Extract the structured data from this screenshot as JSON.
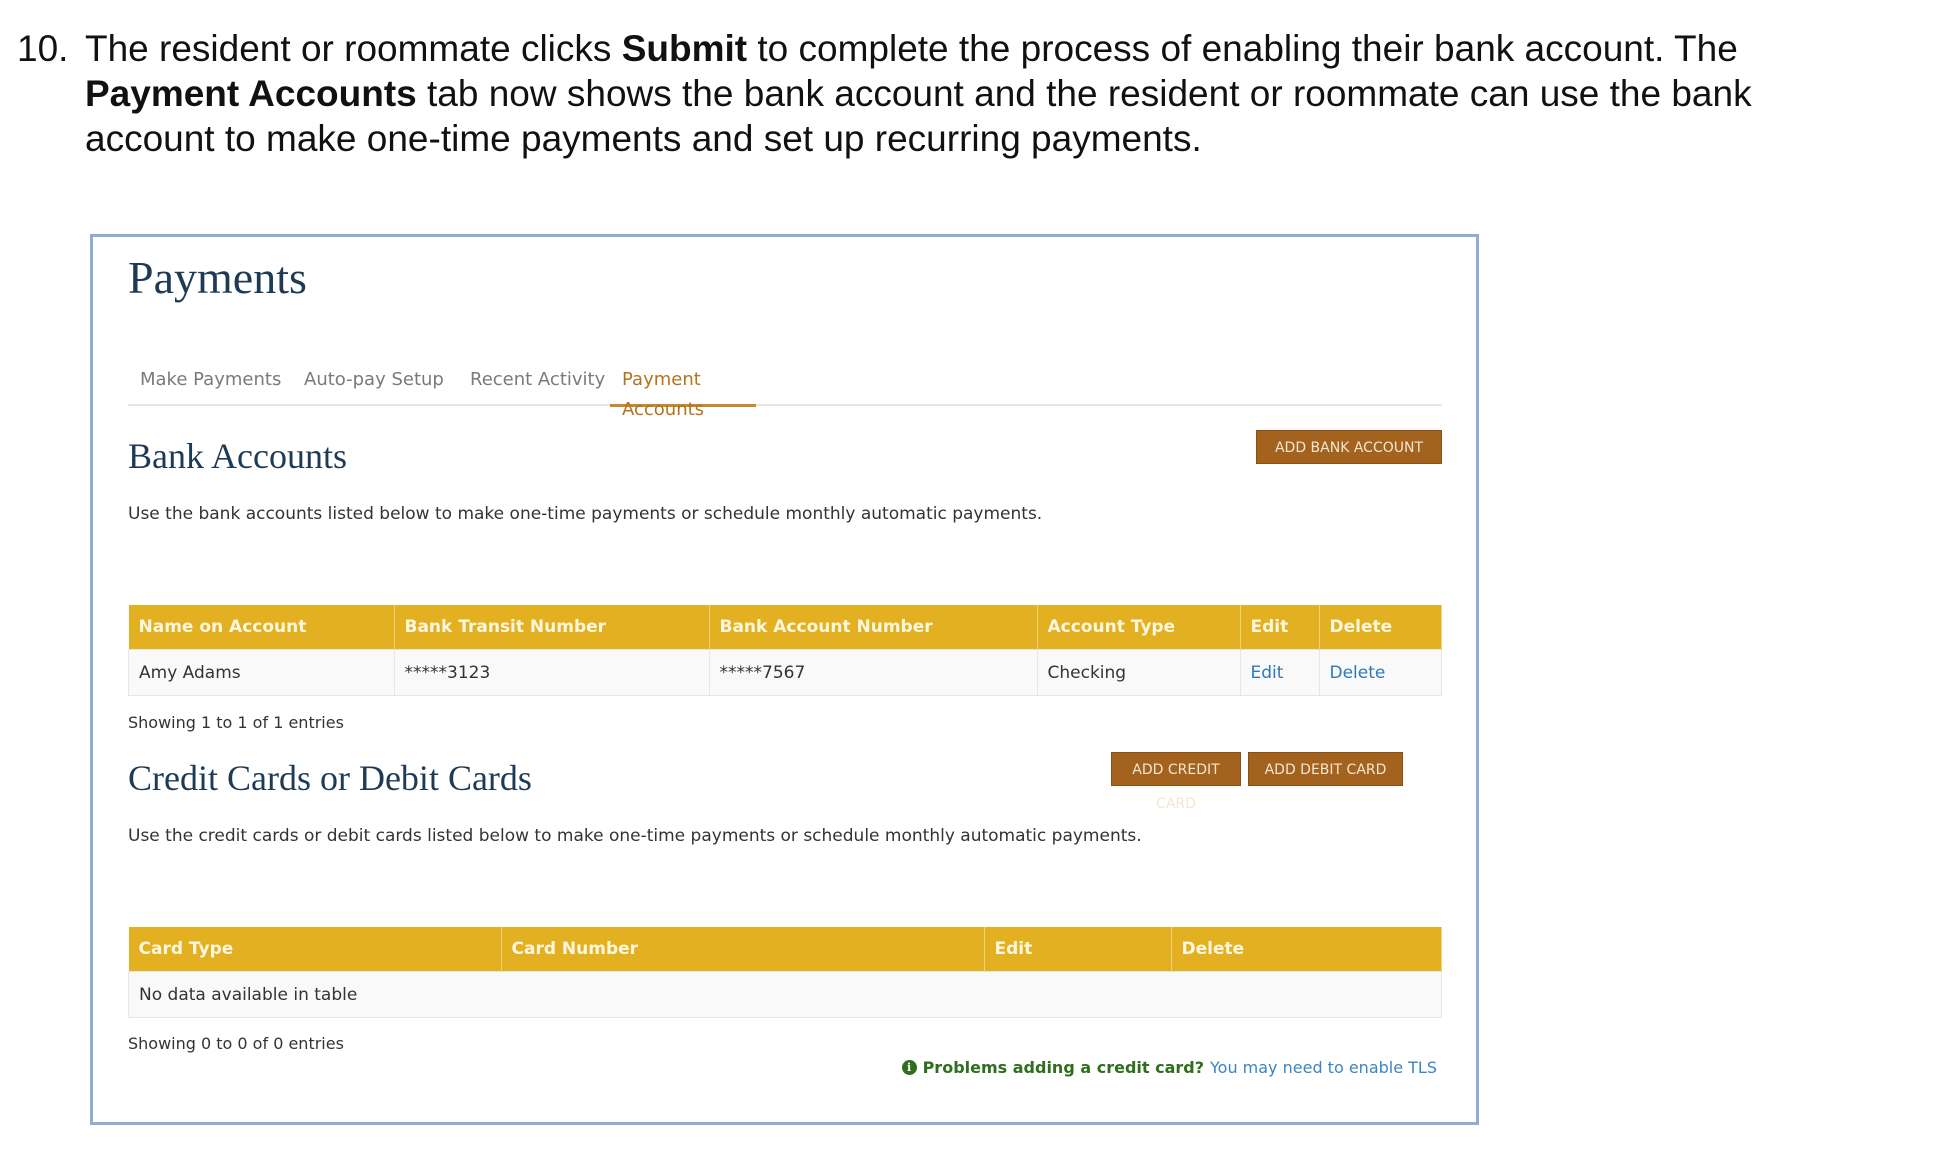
{
  "instruction": {
    "number": "10.",
    "t1": "The resident or roommate clicks ",
    "b1": "Submit",
    "t2": " to complete the process of enabling their bank account. The ",
    "b2": "Payment Accounts",
    "t3": " tab now shows the bank account and the resident or roommate can use the bank account to make one-time payments and set up recurring payments."
  },
  "page": {
    "title": "Payments",
    "tabs": [
      "Make Payments",
      "Auto-pay Setup",
      "Recent Activity",
      "Payment Accounts"
    ],
    "active_tab": "Payment Accounts"
  },
  "bank": {
    "title": "Bank Accounts",
    "description": "Use the bank accounts listed below to make one-time payments or schedule monthly automatic payments.",
    "add_button": "ADD BANK ACCOUNT",
    "columns": [
      "Name on Account",
      "Bank Transit Number",
      "Bank Account Number",
      "Account Type",
      "Edit",
      "Delete"
    ],
    "rows": [
      [
        "Amy Adams",
        "*****3123",
        "*****7567",
        "Checking",
        "Edit",
        "Delete"
      ]
    ],
    "count": "Showing 1 to 1 of 1 entries"
  },
  "cards": {
    "title": "Credit Cards or Debit Cards",
    "description": "Use the credit cards or debit cards listed below to make one-time payments or schedule monthly automatic payments.",
    "add_credit_button": "ADD CREDIT CARD",
    "add_debit_button": "ADD DEBIT CARD",
    "columns": [
      "Card Type",
      "Card Number",
      "Edit",
      "Delete"
    ],
    "empty": "No data available in table",
    "count": "Showing 0 to 0 of 0 entries"
  },
  "notice": {
    "icon": "info-icon",
    "question": "Problems adding a credit card?",
    "link": "You may need to enable TLS"
  },
  "colors": {
    "accent": "#c6892f",
    "button": "#a3621d",
    "table_header": "#e2b020",
    "title": "#1e3b55",
    "link": "#2f78b8"
  }
}
